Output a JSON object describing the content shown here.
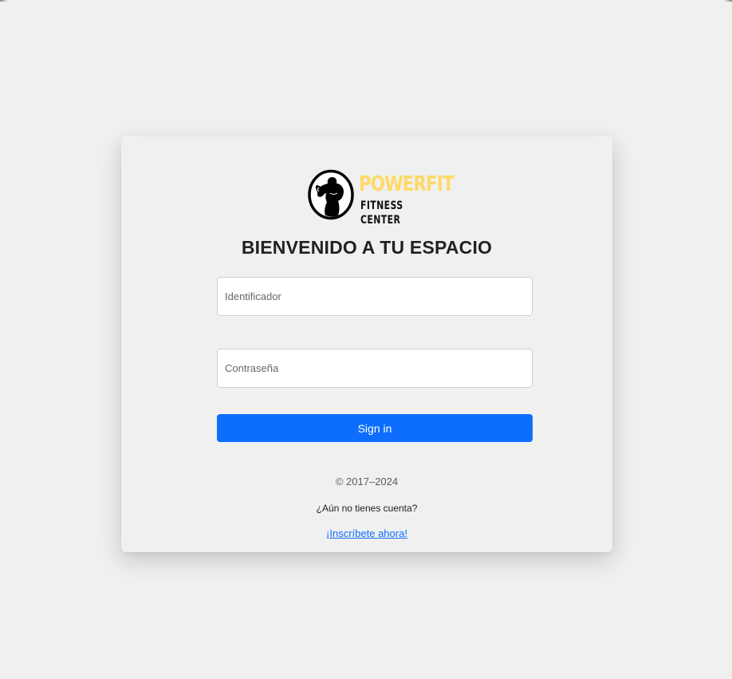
{
  "brand": {
    "name": "POWERFIT",
    "tagline": "FITNESS CENTER",
    "accent_color": "#ffd966"
  },
  "login": {
    "heading": "BIENVENIDO A TU ESPACIO",
    "identifier_placeholder": "Identificador",
    "password_placeholder": "Contraseña",
    "submit_label": "Sign in",
    "button_color": "#0d6efd"
  },
  "footer": {
    "copyright": "© 2017–2024",
    "no_account_text": "¿Aún no tienes cuenta?",
    "signup_link": "¡Inscríbete ahora!"
  }
}
